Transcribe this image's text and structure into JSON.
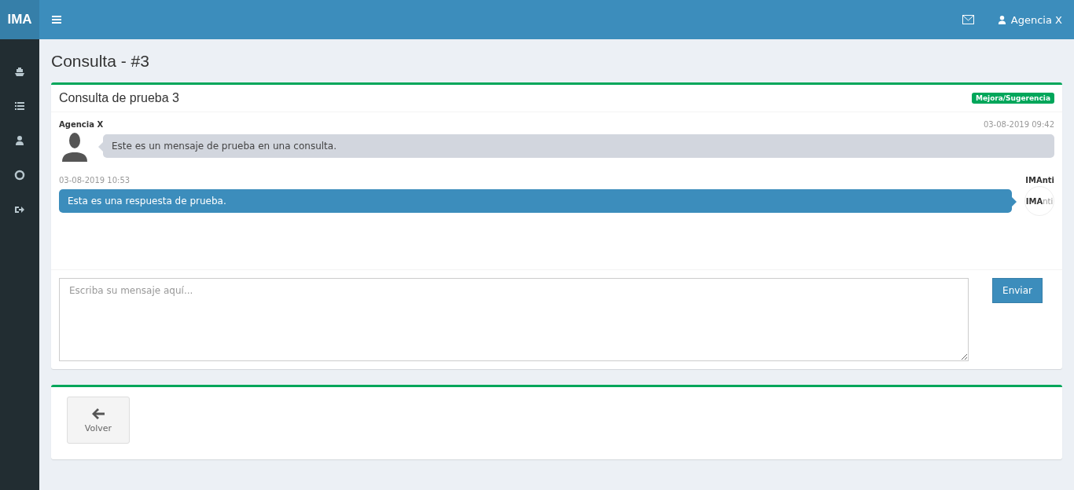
{
  "brand": "IMA",
  "header": {
    "user": "Agencia X"
  },
  "page_title": "Consulta - #3",
  "thread": {
    "title": "Consulta de prueba 3",
    "tag": "Mejora/Sugerencia",
    "messages": [
      {
        "kind": "received",
        "author": "Agencia X",
        "time": "03-08-2019 09:42",
        "text": "Este es un mensaje de prueba en una consulta."
      },
      {
        "kind": "sent",
        "author": "IMAnti",
        "time": "03-08-2019 10:53",
        "text": "Esta es una respuesta de prueba.",
        "avatar_text": "**IMA**nti"
      }
    ],
    "reply": {
      "placeholder": "Escriba su mensaje aquí...",
      "button": "Enviar"
    }
  },
  "back_button": "Volver"
}
